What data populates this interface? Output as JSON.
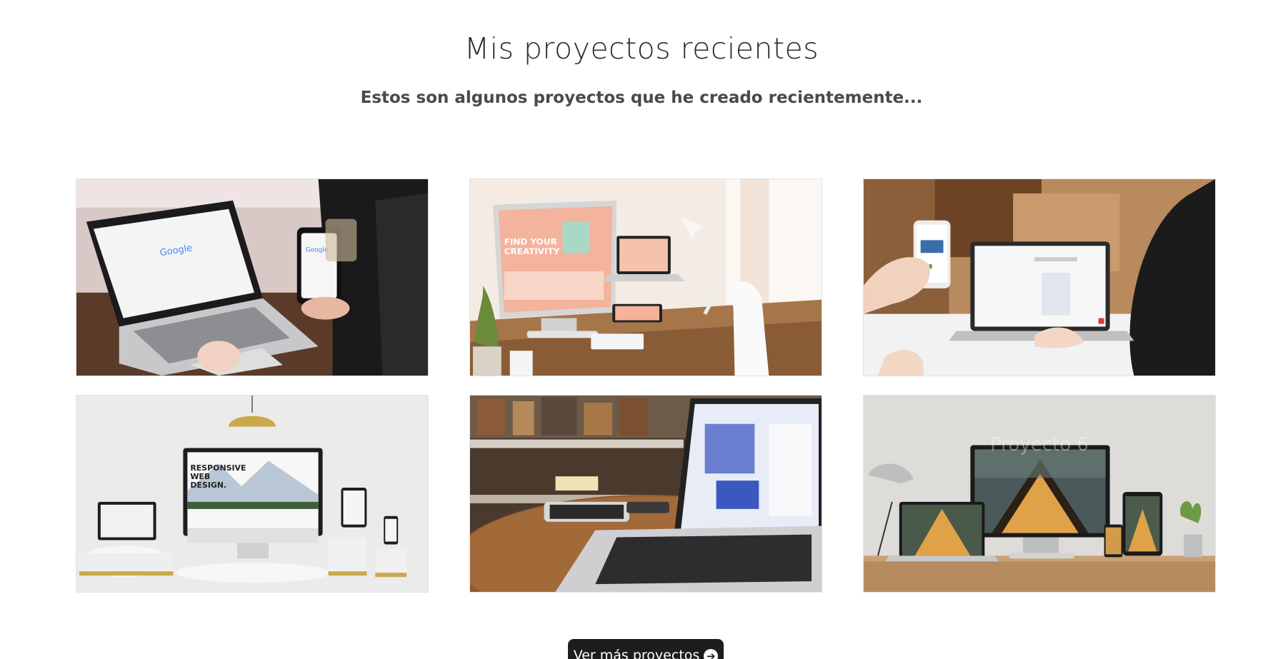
{
  "section": {
    "title": "Mis proyectos recientes",
    "subtitle": "Estos son algunos proyectos que he creado recientemente..."
  },
  "projects": [
    {
      "image": "laptop-phone-google-search-photo"
    },
    {
      "image": "imac-desk-find-your-creativity-photo"
    },
    {
      "image": "phone-laptop-hands-photo"
    },
    {
      "image": "responsive-web-design-devices-photo"
    },
    {
      "image": "laptop-round-table-photo"
    },
    {
      "image": "architect-studio-devices-photo",
      "label": "Proyecto 6"
    }
  ],
  "more_button": {
    "label": "Ver más proyectos",
    "icon": "arrow-right-circle-icon"
  }
}
